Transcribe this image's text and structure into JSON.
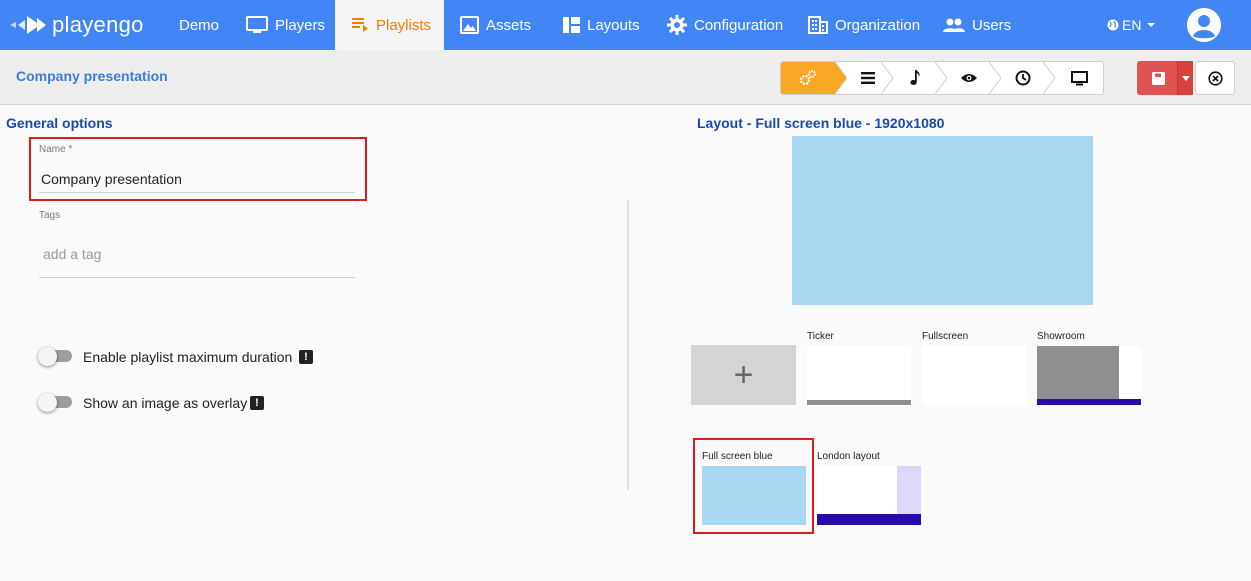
{
  "app": {
    "brand": "playengo"
  },
  "nav": {
    "items": [
      {
        "label": "Demo",
        "icon": "none"
      },
      {
        "label": "Players",
        "icon": "monitor-icon"
      },
      {
        "label": "Playlists",
        "icon": "playlist-icon",
        "active": true
      },
      {
        "label": "Assets",
        "icon": "image-icon"
      },
      {
        "label": "Layouts",
        "icon": "layout-icon"
      },
      {
        "label": "Configuration",
        "icon": "gear-icon"
      },
      {
        "label": "Organization",
        "icon": "building-icon"
      },
      {
        "label": "Users",
        "icon": "users-icon"
      }
    ],
    "language": "EN"
  },
  "header": {
    "title": "Company presentation",
    "steps": [
      "settings-step",
      "list-step",
      "music-step",
      "preview-step",
      "clock-step",
      "display-step"
    ]
  },
  "general": {
    "title": "General options",
    "name_label": "Name *",
    "name_value": "Company presentation",
    "tags_label": "Tags",
    "tags_placeholder": "add a tag",
    "toggle_max_duration": "Enable playlist maximum duration",
    "toggle_overlay": "Show an image as overlay",
    "warn_glyph": "!"
  },
  "layout": {
    "title": "Layout - Full screen blue - 1920x1080",
    "add_glyph": "+",
    "cards": [
      {
        "name": "Ticker"
      },
      {
        "name": "Fullscreen"
      },
      {
        "name": "Showroom"
      },
      {
        "name": "Full screen blue",
        "selected": true
      },
      {
        "name": "London layout"
      }
    ]
  },
  "colors": {
    "nav_bg": "#4285f4",
    "active_tab_text": "#f57c00",
    "step_active": "#f9a825",
    "save_button": "#e05252",
    "preview_blue": "#aad8f2",
    "highlight_red": "#e01b1b",
    "ticker_bar_purple": "#2a0aa8"
  }
}
